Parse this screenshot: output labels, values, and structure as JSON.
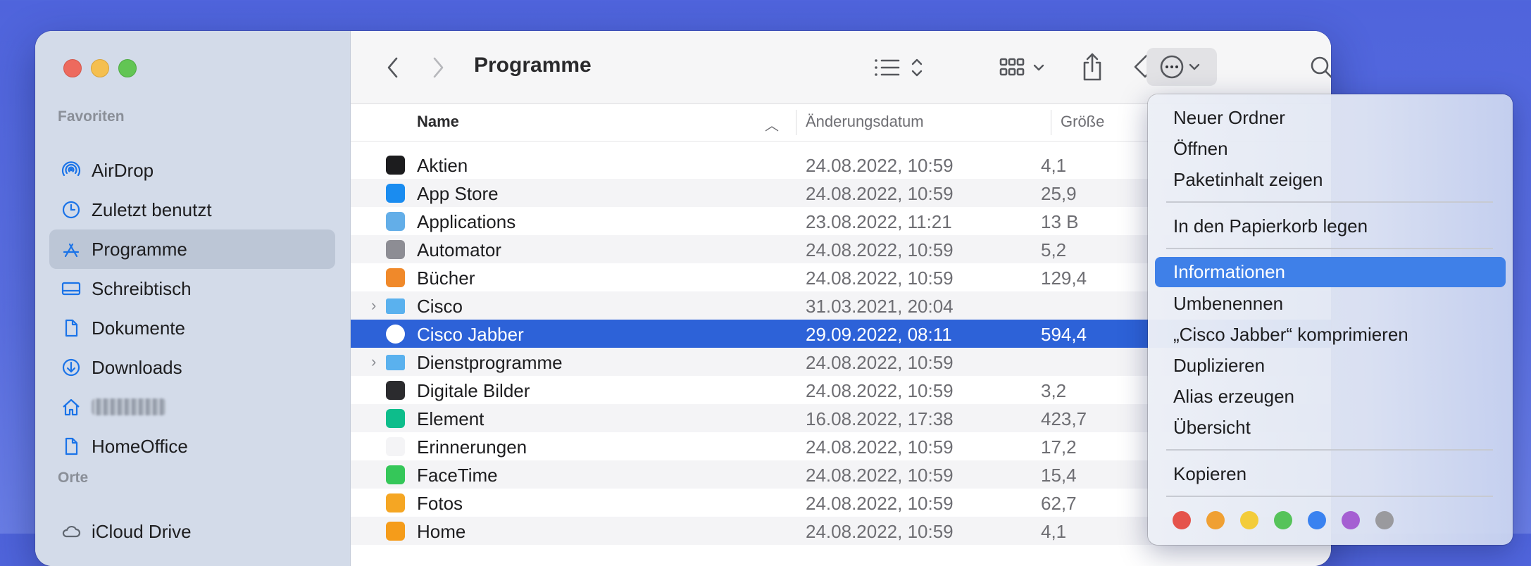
{
  "window": {
    "title": "Programme"
  },
  "sidebar": {
    "favorites_header": "Favoriten",
    "places_header": "Orte",
    "items": [
      {
        "label": "AirDrop",
        "icon": "airdrop-icon"
      },
      {
        "label": "Zuletzt benutzt",
        "icon": "clock-icon"
      },
      {
        "label": "Programme",
        "icon": "applications-icon",
        "selected": true
      },
      {
        "label": "Schreibtisch",
        "icon": "desktop-icon"
      },
      {
        "label": "Dokumente",
        "icon": "document-icon"
      },
      {
        "label": "Downloads",
        "icon": "download-icon"
      },
      {
        "label": "",
        "icon": "home-icon",
        "redacted": true
      },
      {
        "label": "HomeOffice",
        "icon": "document-icon"
      }
    ],
    "places": [
      {
        "label": "iCloud Drive",
        "icon": "cloud-icon"
      }
    ]
  },
  "columns": {
    "name": "Name",
    "date": "Änderungsdatum",
    "size": "Größe"
  },
  "files": [
    {
      "name": "Aktien",
      "date": "24.08.2022, 10:59",
      "size": "4,1",
      "icon_color": "#1c1c1e"
    },
    {
      "name": "App Store",
      "date": "24.08.2022, 10:59",
      "size": "25,9",
      "icon_color": "#1a8cf0"
    },
    {
      "name": "Applications",
      "date": "23.08.2022, 11:21",
      "size": "13 B",
      "icon_color": "#63aee8"
    },
    {
      "name": "Automator",
      "date": "24.08.2022, 10:59",
      "size": "5,2",
      "icon_color": "#8d8d94"
    },
    {
      "name": "Bücher",
      "date": "24.08.2022, 10:59",
      "size": "129,4",
      "icon_color": "#f0892a"
    },
    {
      "name": "Cisco",
      "date": "31.03.2021, 20:04",
      "size": "",
      "icon_color": "#5ab1ee",
      "folder": true
    },
    {
      "name": "Cisco Jabber",
      "date": "29.09.2022, 08:11",
      "size": "594,4",
      "icon_color": "#ffffff",
      "selected": true
    },
    {
      "name": "Dienstprogramme",
      "date": "24.08.2022, 10:59",
      "size": "",
      "icon_color": "#5ab1ee",
      "folder": true
    },
    {
      "name": "Digitale Bilder",
      "date": "24.08.2022, 10:59",
      "size": "3,2",
      "icon_color": "#2b2b2e"
    },
    {
      "name": "Element",
      "date": "16.08.2022, 17:38",
      "size": "423,7",
      "icon_color": "#0dbd8b"
    },
    {
      "name": "Erinnerungen",
      "date": "24.08.2022, 10:59",
      "size": "17,2",
      "icon_color": "#f4f4f6"
    },
    {
      "name": "FaceTime",
      "date": "24.08.2022, 10:59",
      "size": "15,4",
      "icon_color": "#35c759"
    },
    {
      "name": "Fotos",
      "date": "24.08.2022, 10:59",
      "size": "62,7",
      "icon_color": "#f5a623"
    },
    {
      "name": "Home",
      "date": "24.08.2022, 10:59",
      "size": "4,1",
      "icon_color": "#f59c1a"
    }
  ],
  "context_menu": {
    "items": [
      "Neuer Ordner",
      "Öffnen",
      "Paketinhalt zeigen",
      "In den Papierkorb legen",
      "Informationen",
      "Umbenennen",
      "„Cisco Jabber“ komprimieren",
      "Duplizieren",
      "Alias erzeugen",
      "Übersicht",
      "Kopieren"
    ],
    "highlighted": "Informationen",
    "tag_colors": [
      "#e5534b",
      "#f0a033",
      "#f3cc3a",
      "#56c35a",
      "#3a82f0",
      "#a55fd2",
      "#9a9a9e"
    ]
  }
}
